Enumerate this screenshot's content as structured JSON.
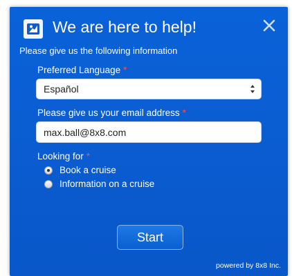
{
  "header": {
    "title": "We are here to help!",
    "logo_icon": "chat-agent-icon",
    "close_icon": "close-icon"
  },
  "form": {
    "intro": "Please give us the following information",
    "required_marker": "*",
    "language": {
      "label": "Preferred Language",
      "selected": "Español"
    },
    "email": {
      "label": "Please give us your email address",
      "value": "max.ball@8x8.com"
    },
    "looking_for": {
      "label": "Looking for",
      "options": [
        {
          "label": "Book a cruise",
          "checked": true
        },
        {
          "label": "Information on a cruise",
          "checked": false
        }
      ]
    },
    "start_label": "Start"
  },
  "footer": {
    "powered_by": "powered by 8x8 Inc."
  },
  "colors": {
    "panel_blue": "#0b5ed3",
    "required_red": "#ff4d4d"
  }
}
